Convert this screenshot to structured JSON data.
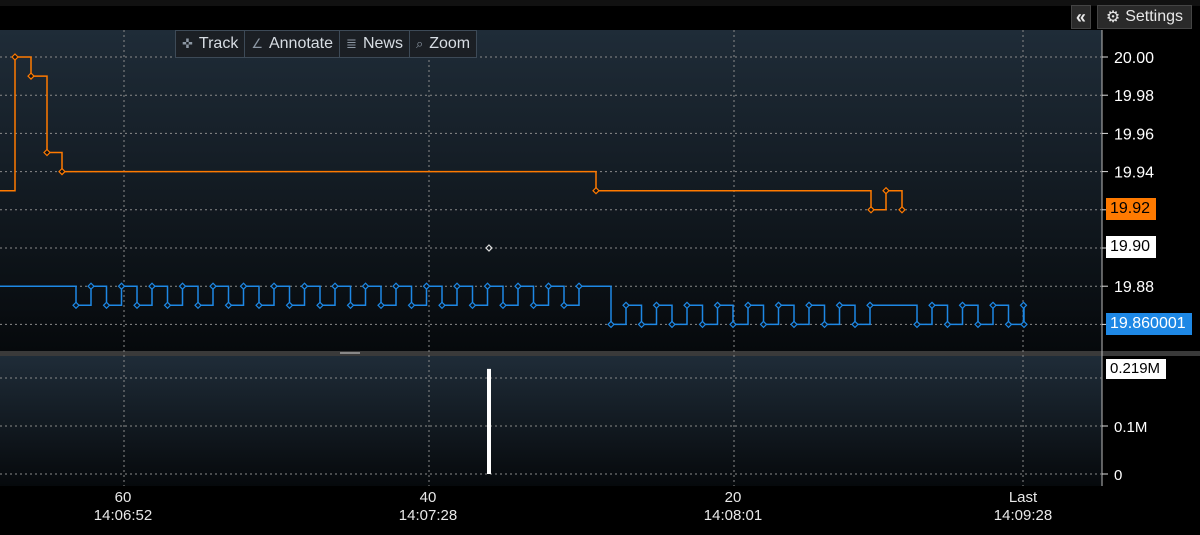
{
  "header": {
    "collapse_icon": "double-chevron-left-icon",
    "settings_icon": "gear-icon",
    "settings_label": "Settings"
  },
  "toolbar": {
    "items": [
      {
        "label": "Track",
        "icon": "crosshair-icon"
      },
      {
        "label": "Annotate",
        "icon": "pencil-icon"
      },
      {
        "label": "News",
        "icon": "list-icon"
      },
      {
        "label": "Zoom",
        "icon": "magnifier-icon"
      }
    ]
  },
  "price_axis": {
    "ticks": [
      "20.00",
      "19.98",
      "19.96",
      "19.94",
      "19.88"
    ],
    "markers": [
      {
        "label": "19.92",
        "color": "#ff7a00",
        "text_color": "#000000"
      },
      {
        "label": "19.90",
        "color": "#ffffff",
        "text_color": "#000000"
      },
      {
        "label": "19.860001",
        "color": "#1e88e5",
        "text_color": "#ffffff"
      }
    ]
  },
  "volume_axis": {
    "ticks": [
      "0.1M",
      "0"
    ],
    "marker": "0.219M"
  },
  "time_axis": [
    {
      "top": "60",
      "bottom": "14:06:52"
    },
    {
      "top": "40",
      "bottom": "14:07:28"
    },
    {
      "top": "20",
      "bottom": "14:08:01"
    },
    {
      "top": "Last",
      "bottom": "14:09:28"
    }
  ],
  "colors": {
    "ask": "#ff7a00",
    "bid": "#1e88e5",
    "trade": "#ffffff",
    "grid": "#8a8a8a",
    "panel_top": "#1f2c38",
    "panel_bottom": "#06090c"
  },
  "chart_data": [
    {
      "type": "line",
      "title": "",
      "x_ticks": [
        "60",
        "40",
        "20",
        "Last"
      ],
      "ylim": [
        19.845,
        20.02
      ],
      "y_ticks": [
        20.0,
        19.98,
        19.96,
        19.94,
        19.92,
        19.9,
        19.88,
        19.86
      ],
      "grid": true,
      "series": [
        {
          "values": [
            19.93,
            20.0,
            19.99,
            19.95,
            19.94,
            19.93,
            19.92,
            19.93,
            19.92
          ],
          "step": true
        },
        {
          "values": [
            19.88,
            19.87,
            19.88,
            19.87,
            19.88,
            19.87,
            19.86,
            19.87,
            19.86
          ],
          "step": true
        },
        {
          "values": [
            19.9
          ],
          "marker_only": true
        }
      ]
    },
    {
      "type": "bar",
      "title": "",
      "ylim": [
        0,
        0.23
      ],
      "y_ticks": [
        0,
        0.1
      ],
      "values": [
        0.219
      ],
      "unit": "M"
    }
  ]
}
